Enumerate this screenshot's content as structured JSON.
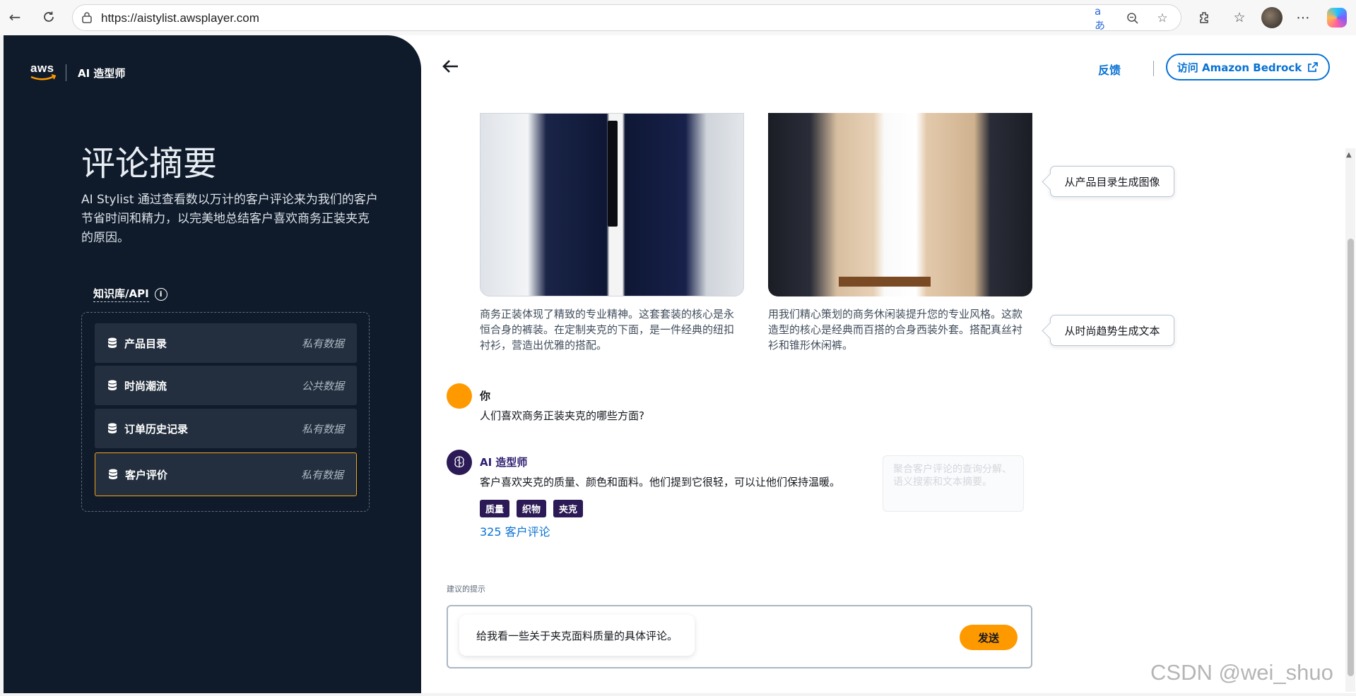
{
  "browser": {
    "url": "https://aistylist.awsplayer.com",
    "read_aloud_glyph": "aあ"
  },
  "sidebar": {
    "brand_logo": "aws",
    "brand_name": "AI 造型师",
    "title": "评论摘要",
    "description": "AI Stylist 通过查看数以万计的客户评论来为我们的客户节省时间和精力，以完美地总结客户喜欢商务正装夹克的原因。",
    "kb_label": "知识库/API",
    "kb_items": [
      {
        "name": "产品目录",
        "type": "私有数据",
        "active": false
      },
      {
        "name": "时尚潮流",
        "type": "公共数据",
        "active": false
      },
      {
        "name": "订单历史记录",
        "type": "私有数据",
        "active": false
      },
      {
        "name": "客户评价",
        "type": "私有数据",
        "active": true
      }
    ]
  },
  "header": {
    "feedback": "反馈",
    "bedrock_button": "访问 Amazon Bedrock"
  },
  "products": {
    "left_caption": "商务正装体现了精致的专业精神。这套套装的核心是永恒合身的裤装。在定制夹克的下面，是一件经典的纽扣衬衫，营造出优雅的搭配。",
    "right_caption": "用我们精心策划的商务休闲装提升您的专业风格。这款造型的核心是经典而百搭的合身西装外套。搭配真丝衬衫和锥形休闲裤。"
  },
  "callouts": {
    "image_gen": "从产品目录生成图像",
    "text_gen": "从时尚趋势生成文本",
    "faded": "聚合客户评论的查询分解、语义搜索和文本摘要。"
  },
  "chat": {
    "user_name": "你",
    "user_message": "人们喜欢商务正装夹克的哪些方面?",
    "ai_name": "AI 造型师",
    "ai_message": "客户喜欢夹克的质量、颜色和面料。他们提到它很轻，可以让他们保持温暖。",
    "tags": [
      "质量",
      "织物",
      "夹克"
    ],
    "reviews_link": "325 客户评论"
  },
  "composer": {
    "suggest_label": "建议的提示",
    "suggestion": "给我看一些关于夹克面料质量的具体评论。",
    "send": "发送"
  },
  "watermark": "CSDN @wei_shuo",
  "colors": {
    "sidebar_bg": "#0f1b2a",
    "accent_orange": "#ff9900",
    "link_blue": "#0972d3",
    "ai_purple": "#2b1a55"
  }
}
